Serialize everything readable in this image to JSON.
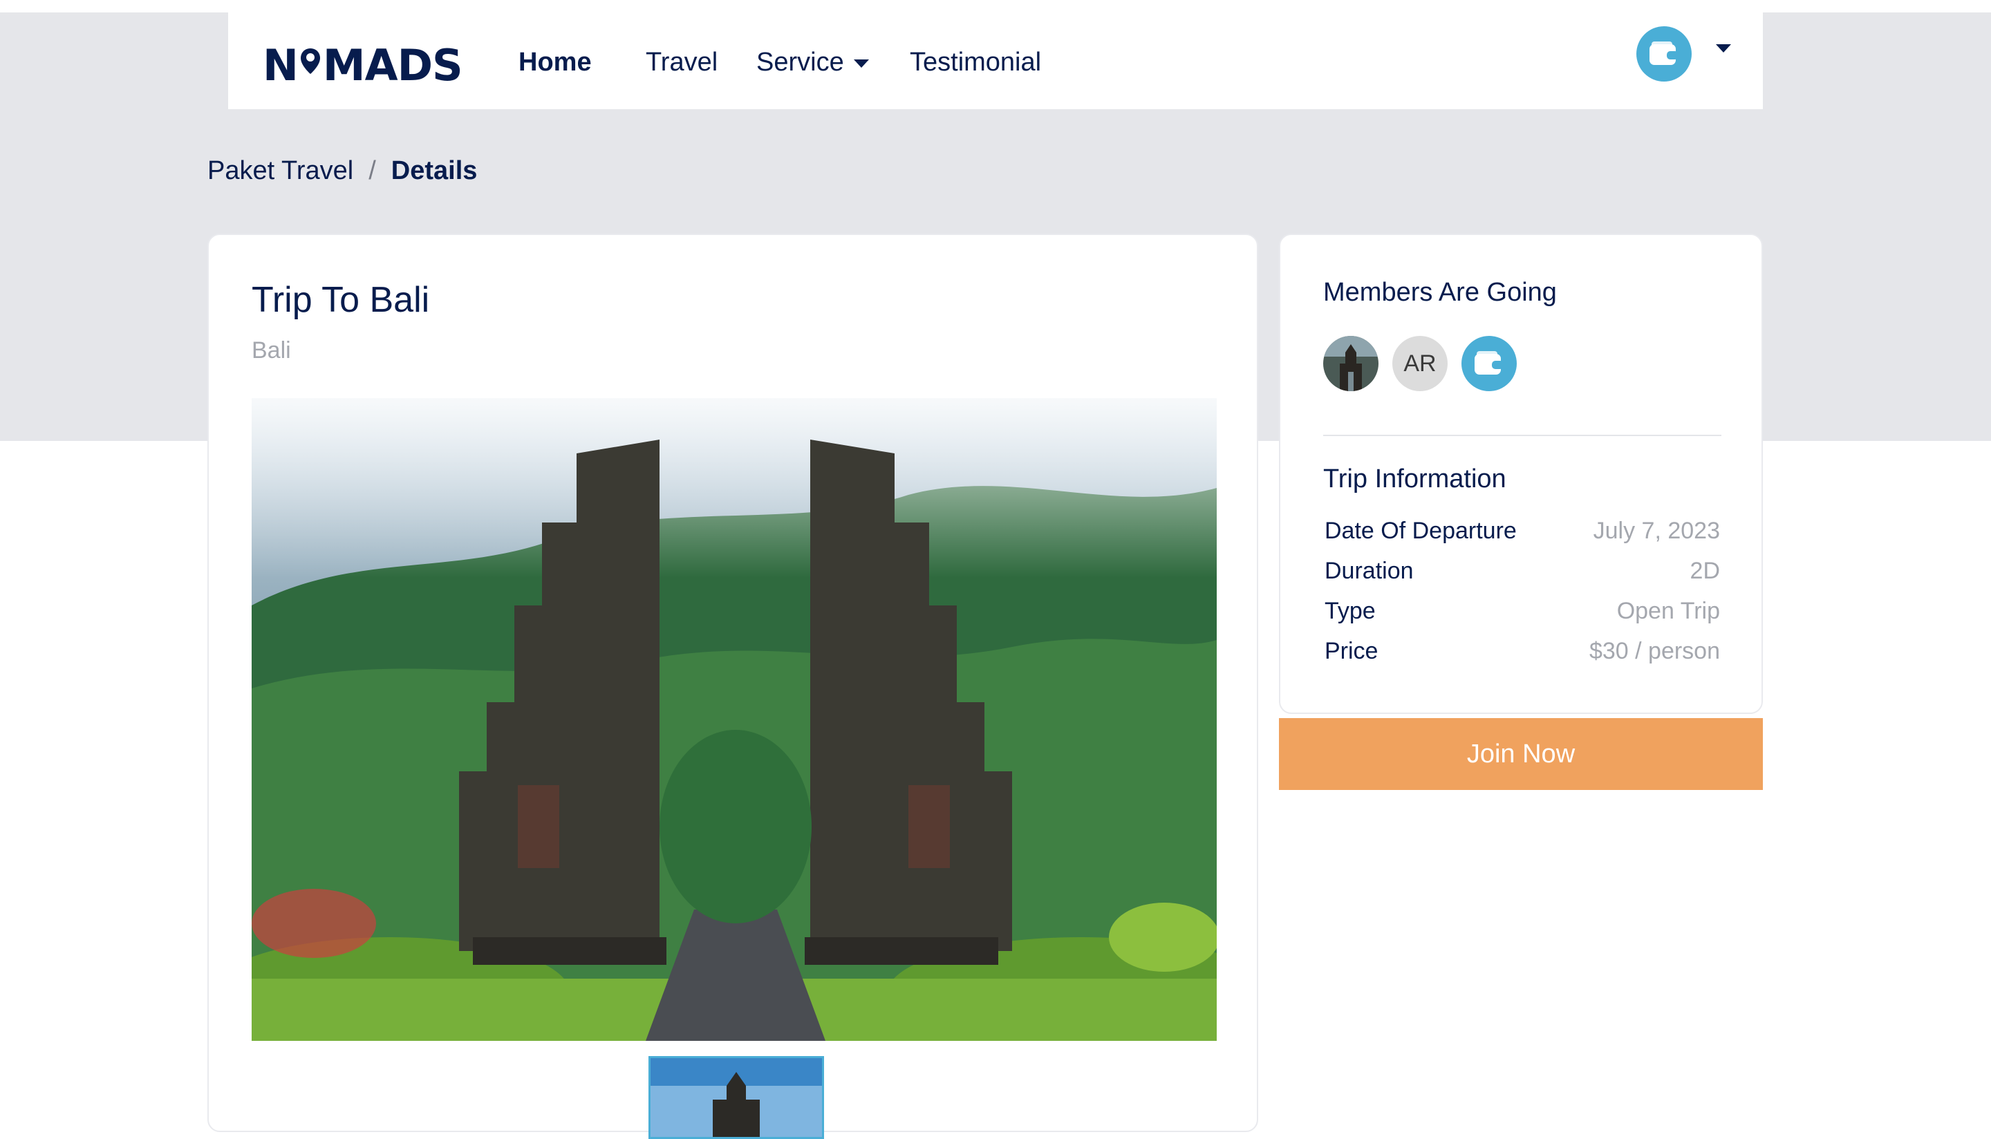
{
  "brand": {
    "left": "N",
    "right": "MADS"
  },
  "nav": {
    "items": [
      {
        "label": "Home",
        "active": true
      },
      {
        "label": "Travel"
      },
      {
        "label": "Service",
        "dropdown": true
      },
      {
        "label": "Testimonial"
      }
    ],
    "user_avatar_icon": "wallet-icon"
  },
  "breadcrumb": {
    "items": [
      "Paket Travel",
      "Details"
    ],
    "separator": "/"
  },
  "trip": {
    "title": "Trip To Bali",
    "location": "Bali",
    "gallery": {
      "main_image": "bali-temple-gate-photo",
      "thumbnails": 1
    }
  },
  "sidebar": {
    "members_heading": "Members Are Going",
    "members": [
      {
        "type": "photo",
        "icon": "temple-photo-avatar"
      },
      {
        "type": "initials",
        "label": "AR"
      },
      {
        "type": "icon",
        "icon": "wallet-icon"
      }
    ],
    "info_heading": "Trip Information",
    "info": [
      {
        "label": "Date Of Departure",
        "value": "July 7, 2023"
      },
      {
        "label": "Duration",
        "value": "2D"
      },
      {
        "label": "Type",
        "value": "Open Trip"
      },
      {
        "label": "Price",
        "value": "$30 / person"
      }
    ],
    "cta": "Join Now"
  },
  "colors": {
    "navy": "#071c4d",
    "accent_blue": "#4aaed6",
    "cta_orange": "#f0a25e",
    "band_gray": "#e5e6ea",
    "muted_text": "#a4a7ae"
  }
}
